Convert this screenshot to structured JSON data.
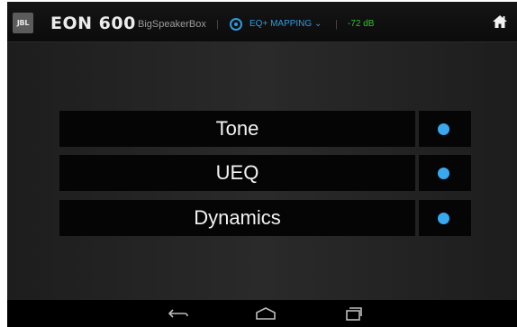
{
  "header": {
    "logo_text": "JBL",
    "product": "EON 600",
    "device_name": "BigSpeakerBox",
    "separator": "|",
    "mode_label": "EQ+ MAPPING",
    "mode_caret": "⌄",
    "level": "-72 dB",
    "home_icon": "home-icon"
  },
  "menu": {
    "items": [
      {
        "label": "Tone"
      },
      {
        "label": "UEQ"
      },
      {
        "label": "Dynamics"
      }
    ]
  },
  "navbar": {
    "buttons": [
      "back-icon",
      "home-outline-icon",
      "recent-apps-icon"
    ]
  },
  "colors": {
    "accent": "#2e9be0",
    "level_green": "#2fc22f",
    "background": "#1a1a1a"
  }
}
